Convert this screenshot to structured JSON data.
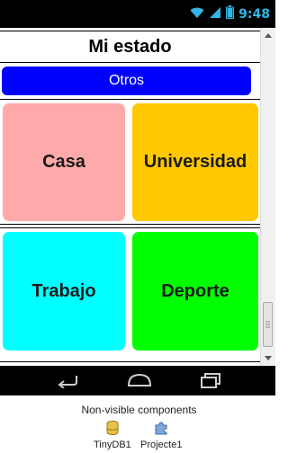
{
  "status_bar": {
    "time": "9:48",
    "wifi_icon": "wifi-icon",
    "signal_icon": "signal-icon",
    "battery_icon": "battery-icon"
  },
  "screen": {
    "title": "Mi estado",
    "otros_button": {
      "label": "Otros",
      "color": "#0000ff"
    },
    "tiles": [
      {
        "label": "Casa",
        "color": "#ffaaaa"
      },
      {
        "label": "Universidad",
        "color": "#ffc800"
      },
      {
        "label": "Trabajo",
        "color": "#00ffff"
      },
      {
        "label": "Deporte",
        "color": "#00ff00"
      }
    ]
  },
  "nav_bar": {
    "back_icon": "back-icon",
    "home_icon": "home-icon",
    "recents_icon": "recents-icon"
  },
  "non_visible": {
    "title": "Non-visible components",
    "components": [
      {
        "label": "TinyDB1",
        "icon": "database-icon"
      },
      {
        "label": "Projecte1",
        "icon": "puzzle-icon"
      }
    ]
  }
}
